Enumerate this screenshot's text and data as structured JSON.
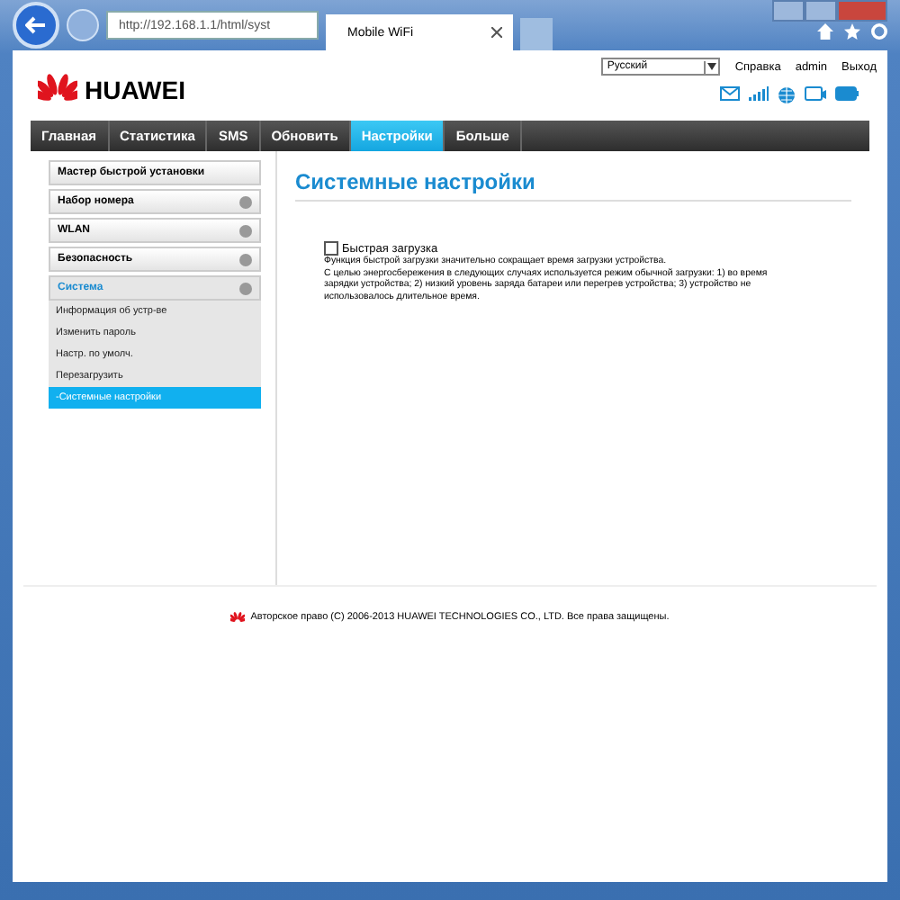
{
  "browser": {
    "address": "http://192.168.1.1/html/syst",
    "tab_title": "Mobile WiFi"
  },
  "header": {
    "logo": "HUAWEI",
    "language": "Русский",
    "links": [
      "Справка",
      "admin",
      "Выход"
    ]
  },
  "nav": [
    {
      "label": "Главная",
      "selected": false
    },
    {
      "label": "Статистика",
      "selected": false
    },
    {
      "label": "SMS",
      "selected": false
    },
    {
      "label": "Обновить",
      "selected": false
    },
    {
      "label": "Настройки",
      "selected": true
    },
    {
      "label": "Больше",
      "selected": false
    }
  ],
  "sidebar": [
    {
      "label": "Мастер быстрой установки",
      "kind": "plain",
      "expanded": false
    },
    {
      "label": "Набор номера",
      "kind": "group",
      "expanded": false
    },
    {
      "label": "WLAN",
      "kind": "group",
      "expanded": false
    },
    {
      "label": "Безопасность",
      "kind": "group",
      "expanded": false
    },
    {
      "label": "Система",
      "kind": "group",
      "expanded": true,
      "children": [
        {
          "label": "Информация об устр-ве",
          "selected": false
        },
        {
          "label": "Изменить пароль",
          "selected": false
        },
        {
          "label": "Настр. по умолч.",
          "selected": false
        },
        {
          "label": "Перезагрузить",
          "selected": false
        },
        {
          "label": "-Системные настройки",
          "selected": true
        }
      ]
    }
  ],
  "content": {
    "title": "Системные настройки",
    "option": {
      "label": "Быстрая загрузка",
      "checked": false
    },
    "description": [
      "Функция быстрой загрузки значительно сокращает время загрузки устройства.",
      "С целью энергосбережения в следующих случаях используется режим обычной загрузки: 1) во время зарядки устройства; 2) низкий уровень заряда батареи или перегрев устройства; 3) устройство не использовалось длительное время."
    ]
  },
  "footer": "Авторское право (C) 2006-2013 HUAWEI TECHNOLOGIES CO., LTD. Все права защищены."
}
